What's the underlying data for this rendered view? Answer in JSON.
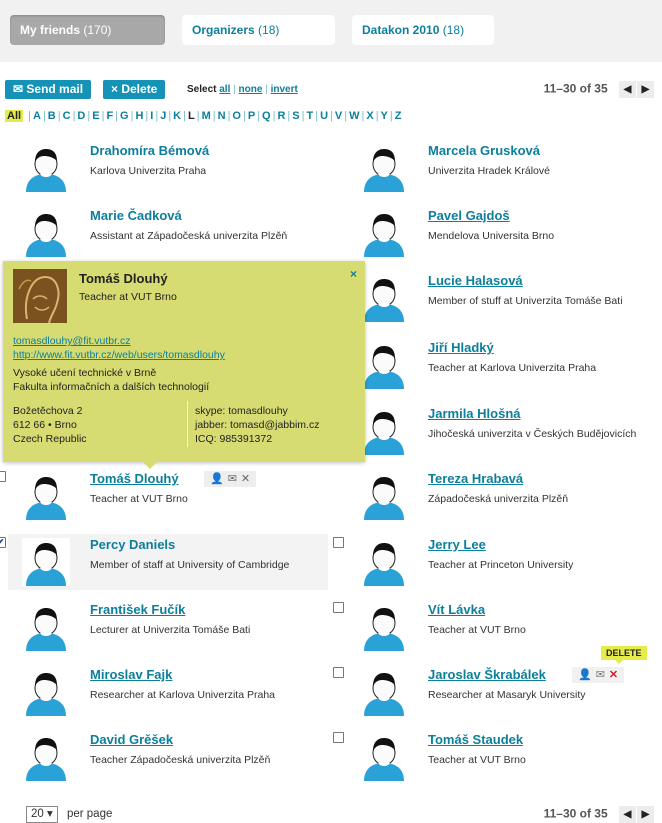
{
  "tabs": [
    {
      "label": "My friends",
      "count": "(170)"
    },
    {
      "label": "Organizers",
      "count": "(18)"
    },
    {
      "label": "Datakon 2010",
      "count": "(18)"
    }
  ],
  "toolbar": {
    "send_mail": "✉ Send mail",
    "delete": "× Delete",
    "select_prefix": "Select",
    "select_all": "all",
    "select_none": "none",
    "select_invert": "invert",
    "sep": "|"
  },
  "pager": {
    "range": "11–30 of 35",
    "prev": "◀",
    "next": "▶"
  },
  "alphabet": {
    "all": "All",
    "letters": [
      "A",
      "B",
      "C",
      "D",
      "E",
      "F",
      "G",
      "H",
      "I",
      "J",
      "K",
      "L",
      "M",
      "N",
      "O",
      "P",
      "Q",
      "R",
      "S",
      "T",
      "U",
      "V",
      "W",
      "X",
      "Y",
      "Z"
    ]
  },
  "contacts": [
    {
      "name": "Drahomíra Bémová",
      "sub": "Karlova Univerzita Praha"
    },
    {
      "name": "Marcela Grusková",
      "sub": "Univerzita Hradek Králové"
    },
    {
      "name": "Marie Čadková",
      "sub": "Assistant at Západočeská univerzita Plzěň"
    },
    {
      "name": "Pavel Gajdoš",
      "sub": "Mendelova Universita Brno"
    },
    {
      "name": "Lucie Halasová",
      "sub": "Member of stuff at Univerzita Tomáše Bati"
    },
    {
      "name": "Jiří Hladký",
      "sub": "Teacher at Karlova Univerzita Praha"
    },
    {
      "name": "Jarmila Hlošná",
      "sub": "Jihočeská univerzita v Českých Budějovicích"
    },
    {
      "name": "Tomáš Dlouhý",
      "sub": "Teacher at VUT Brno"
    },
    {
      "name": "Tereza Hrabavá",
      "sub": "Západočeská univerzita Plzěň"
    },
    {
      "name": "Percy Daniels",
      "sub": "Member of staff at University of Cambridge"
    },
    {
      "name": "Jerry Lee",
      "sub": "Teacher at Princeton University"
    },
    {
      "name": "František Fučík",
      "sub": "Lecturer at Univerzita Tomáše Bati"
    },
    {
      "name": "Vít Lávka",
      "sub": "Teacher at VUT Brno"
    },
    {
      "name": "Miroslav Fajk",
      "sub": "Researcher at Karlova Univerzita Praha"
    },
    {
      "name": "Jaroslav Škrabálek",
      "sub": "Researcher at Masaryk University"
    },
    {
      "name": "David Grěšek",
      "sub": "Teacher Západočeská univerzita Plzěň"
    },
    {
      "name": "Tomáš Staudek",
      "sub": "Teacher at VUT Brno"
    }
  ],
  "row_actions": {
    "person": "👤",
    "mail": "✉",
    "remove": "✕"
  },
  "checkmark": "✔",
  "popup": {
    "name": "Tomáš Dlouhý",
    "title": "Teacher at VUT Brno",
    "close": "×",
    "email": "tomasdlouhy@fit.vutbr.cz",
    "url": "http://www.fit.vutbr.cz/web/users/tomasdlouhy",
    "org1": "Vysoké učení technické v Brně",
    "org2": "Fakulta informačních a dalších technologií",
    "addr1": "Božetěchova 2",
    "addr2": "612 66 • Brno",
    "addr3": "Czech Republic",
    "skype": "skype:  tomasdlouhy",
    "jabber": "jabber:  tomasd@jabbim.cz",
    "icq": "ICQ:    985391372"
  },
  "delete_tip": "DELETE",
  "per_page": {
    "value": "20 ▾",
    "label": "per page"
  },
  "colors": {
    "accent": "#0b7f9c",
    "button": "#1592b8",
    "highlight": "#e4eb4a",
    "popup": "#d6dc72"
  }
}
